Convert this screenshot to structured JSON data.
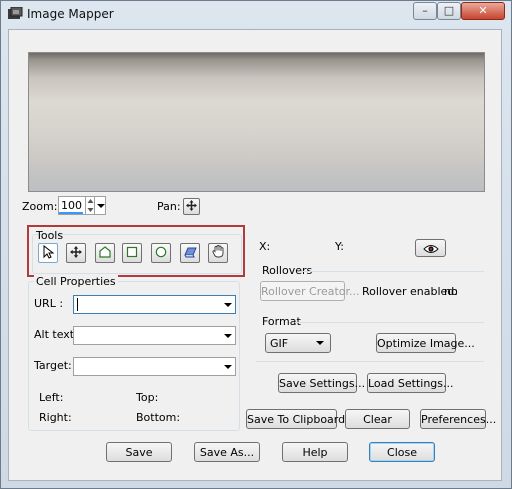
{
  "window": {
    "title": "Image Mapper"
  },
  "caption_buttons": {
    "minimize": "–",
    "maximize": "□",
    "close": "✕"
  },
  "zoom": {
    "label": "Zoom:",
    "value": "100"
  },
  "pan": {
    "label": "Pan:"
  },
  "tools": {
    "title": "Tools",
    "items": [
      {
        "icon": "arrow-select-icon",
        "active": true
      },
      {
        "icon": "move-icon"
      },
      {
        "icon": "polygon-icon"
      },
      {
        "icon": "rectangle-icon"
      },
      {
        "icon": "circle-icon"
      },
      {
        "icon": "eraser-icon"
      },
      {
        "icon": "hand-icon"
      }
    ]
  },
  "coords": {
    "x_label": "X:",
    "y_label": "Y:"
  },
  "cell_properties": {
    "title": "Cell Properties",
    "url_label": "URL :",
    "url_value": "",
    "alt_label": "Alt text:",
    "alt_value": "",
    "target_label": "Target:",
    "target_value": "",
    "left_label": "Left:",
    "top_label": "Top:",
    "right_label": "Right:",
    "bottom_label": "Bottom:"
  },
  "rollovers": {
    "title": "Rollovers",
    "creator_button": "Rollover Creator...",
    "enabled_label": "Rollover enabled:",
    "enabled_value": "no"
  },
  "format": {
    "title": "Format",
    "selected": "GIF",
    "optimize_button": "Optimize Image..."
  },
  "settings": {
    "save": "Save Settings...",
    "load": "Load Settings..."
  },
  "actions": {
    "clipboard": "Save To Clipboard...",
    "clear": "Clear",
    "preferences": "Preferences..."
  },
  "footer": {
    "save": "Save",
    "save_as": "Save As...",
    "help": "Help",
    "close": "Close"
  },
  "colors": {
    "highlight": "#b33a3a",
    "default_button_border": "#3c7fb1"
  }
}
